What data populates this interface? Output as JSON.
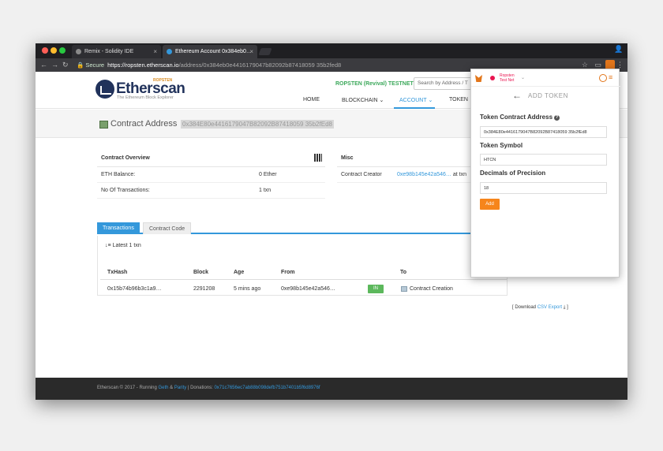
{
  "browser": {
    "tabs": [
      {
        "title": "Remix - Solidity IDE"
      },
      {
        "title": "Ethereum Account 0x384eb0…"
      }
    ],
    "url_secure": "Secure",
    "url_host": "https://ropsten.etherscan.io",
    "url_path": "/address/0x384eb0e4416179047b82092b87418059 35b2fed8"
  },
  "site": {
    "logo_word": "Etherscan",
    "logo_tag": "ROPSTEN",
    "logo_sub": "The Ethereum Block Explorer",
    "network": "ROPSTEN (Revival) TESTNET",
    "search_placeholder": "Search by Address / T",
    "nav": {
      "home": "HOME",
      "blockchain": "BLOCKCHAIN",
      "account": "ACCOUNT",
      "token": "TOKEN"
    }
  },
  "contract": {
    "title": "Contract Address",
    "address": "0x384E80e4416179047B82092B87418059 35b2fEd8"
  },
  "overview": {
    "heading": "Contract Overview",
    "rows": [
      {
        "key": "ETH Balance:",
        "value": "0 Ether"
      },
      {
        "key": "No Of Transactions:",
        "value": "1 txn"
      }
    ]
  },
  "misc": {
    "heading": "Misc",
    "creator_key": "Contract Creator",
    "creator_value": "0xe98b145e42a546…",
    "creator_suffix": "at txn"
  },
  "tx_tabs": {
    "transactions": "Transactions",
    "contract_code": "Contract Code"
  },
  "tx_table": {
    "latest": "Latest 1 txn",
    "headers": {
      "hash": "TxHash",
      "block": "Block",
      "age": "Age",
      "from": "From",
      "to": "To"
    },
    "row": {
      "hash": "0x15b74b96b3c1a9…",
      "block": "2291208",
      "age": "5 mins ago",
      "from": "0xe98b145e42a546…",
      "direction": "IN",
      "to": "Contract Creation"
    }
  },
  "csv": {
    "prefix": "[ Download",
    "link": "CSV Export",
    "suffix": "]"
  },
  "footer": {
    "text": "Etherscan © 2017 - Running",
    "geth": "Geth",
    "amp": "&",
    "parity": "Parity",
    "donations_label": "| Donations:",
    "donations_addr": "0x71c7656ec7ab88b098defb751b7401b5f6d8976f"
  },
  "metamask": {
    "network_line1": "Ropsten",
    "network_line2": "Test Net",
    "title": "ADD TOKEN",
    "contract_label": "Token Contract Address",
    "contract_value": "0x384E80e4416179047B82092B87418059 35b2fEd8",
    "symbol_label": "Token Symbol",
    "symbol_value": "HTCN",
    "decimals_label": "Decimals of Precision",
    "decimals_value": "18",
    "add_button": "Add"
  }
}
